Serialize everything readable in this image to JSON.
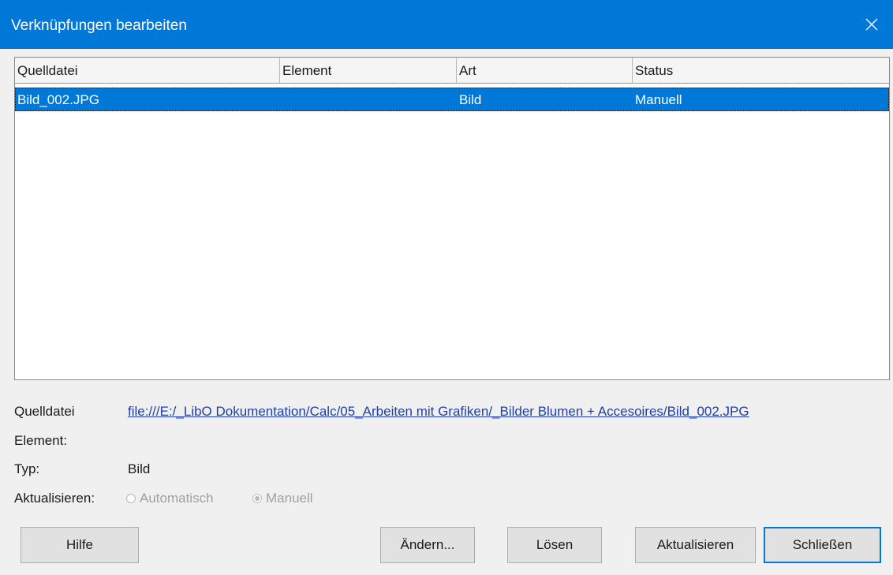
{
  "window": {
    "title": "Verknüpfungen bearbeiten",
    "close_icon": "close-icon"
  },
  "list": {
    "columns": [
      "Quelldatei",
      "Element",
      "Art",
      "Status"
    ],
    "rows": [
      {
        "source": "Bild_002.JPG",
        "element": "",
        "type": "Bild",
        "status": "Manuell",
        "selected": true
      }
    ]
  },
  "details": {
    "source_label": "Quelldatei",
    "source_value": "file:///E:/_LibO Dokumentation/Calc/05_Arbeiten mit Grafiken/_Bilder Blumen + Accesoires/Bild_002.JPG",
    "element_label": "Element:",
    "type_label": "Typ:",
    "type_value": "Bild",
    "update_label": "Aktualisieren:",
    "update_auto": "Automatisch",
    "update_manual": "Manuell",
    "update_selected": "Manuell"
  },
  "buttons": {
    "help": "Hilfe",
    "modify": "Ändern...",
    "break": "Lösen",
    "update": "Aktualisieren",
    "close": "Schließen"
  }
}
